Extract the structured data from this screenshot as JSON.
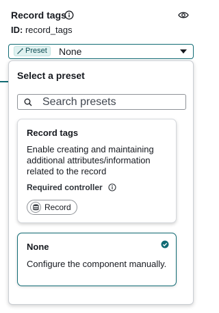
{
  "header": {
    "title": "Record tags",
    "id_label": "ID:",
    "id_value": "record_tags"
  },
  "select": {
    "badge_label": "Preset",
    "value": "None"
  },
  "dropdown": {
    "heading": "Select a preset",
    "search_placeholder": "Search presets",
    "cards": [
      {
        "title": "Record tags",
        "description": "Enable creating and maintaining additional attributes/information related to the record",
        "required_label": "Required controller",
        "chip_label": "Record",
        "selected": false
      },
      {
        "title": "None",
        "description": "Configure the component manually.",
        "selected": true
      }
    ]
  },
  "colors": {
    "accent": "#0f6a73",
    "badge_bg": "#dff1f0"
  },
  "icons": [
    "info-icon",
    "eye-icon",
    "magic-wand-icon",
    "caret-down-icon",
    "search-icon",
    "database-icon",
    "check-circle-icon"
  ]
}
